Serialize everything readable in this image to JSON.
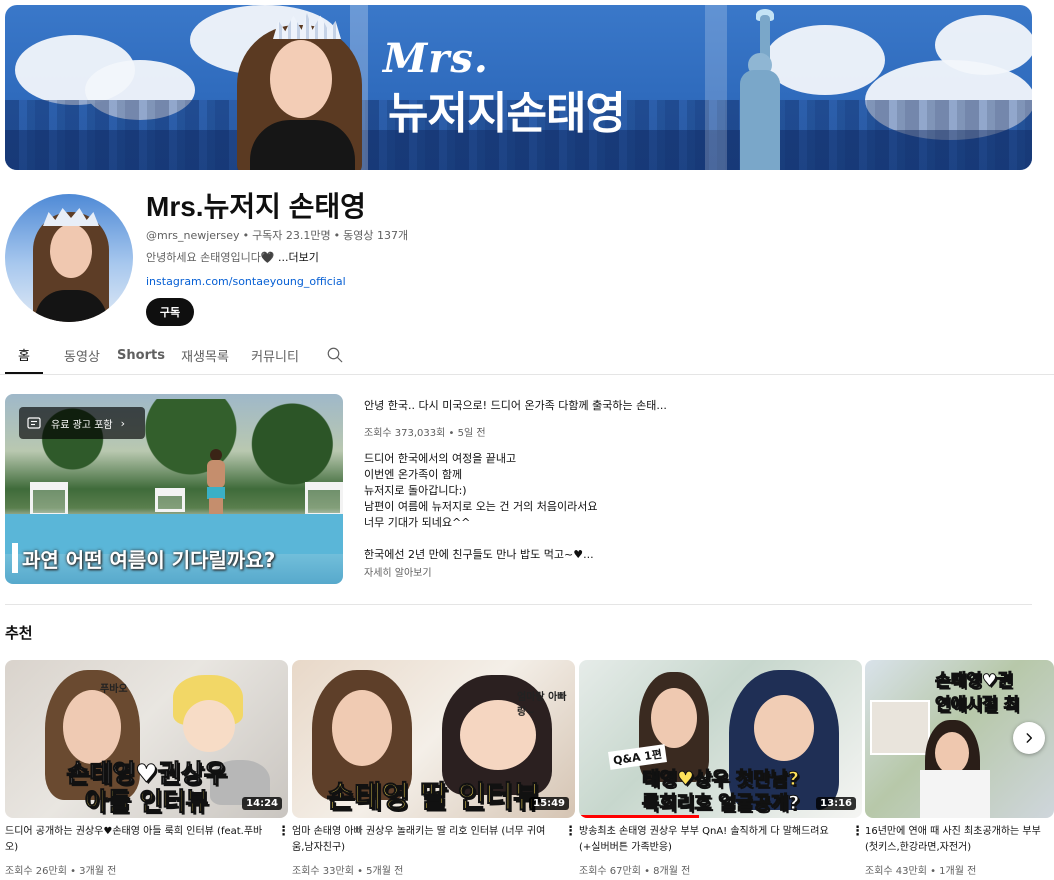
{
  "banner": {
    "title_line1": "Mrs.",
    "title_line2": "뉴저지손태영"
  },
  "channel": {
    "name": "Mrs.뉴저지 손태영",
    "handle": "@mrs_newjersey",
    "subscribers": "구독자 23.1만명",
    "videos": "동영상 137개",
    "description": "안녕하세요 손태영입니다🖤",
    "more_label": "...더보기",
    "link": "instagram.com/sontaeyoung_official",
    "subscribe_label": "구독"
  },
  "tabs": [
    {
      "label": "홈",
      "active": true
    },
    {
      "label": "동영상",
      "active": false
    },
    {
      "label": "Shorts",
      "active": false
    },
    {
      "label": "재생목록",
      "active": false
    },
    {
      "label": "커뮤니티",
      "active": false
    }
  ],
  "icons": {
    "tab_search": "search-icon",
    "ad_badge": "ad-icon",
    "carousel_next": "chevron-right-icon",
    "card_menu": "more-vert-icon"
  },
  "featured": {
    "ad_badge_label": "유료 광고 포함",
    "thumbnail_caption": "과연 어떤 여름이 기다릴까요?",
    "title": "안녕 한국.. 다시 미국으로! 드디어 온가족 다함께 출국하는 손태...",
    "stats": "조회수 373,033회 • 5일 전",
    "description_lines": [
      "드디어 한국에서의 여정을 끝내고",
      "이번엔 온가족이 함께",
      "뉴저지로 돌아갑니다:)",
      "남편이 여름에 뉴저지로 오는 건 거의 처음이라서요",
      "너무 기대가 되네요^^",
      "",
      "한국에선 2년 만에 친구들도 만나 밥도 먹고~♥..."
    ],
    "more_label": "자세히 알아보기"
  },
  "recommended": {
    "section_title": "추천",
    "videos": [
      {
        "thumb_text_top": "손태영♥권상우",
        "thumb_text_bottom": "아들 인터뷰",
        "thumb_overlay": "푸바오",
        "duration": "14:24",
        "title": "드디어 공개하는 권상우♥손태영 아들 룩희 인터뷰 (feat.푸바오)",
        "stats": "조회수 26만회 • 3개월 전"
      },
      {
        "thumb_text_top": "",
        "thumb_text_bottom": "손태영 딸 인터뷰",
        "thumb_overlay": "엄마랑 아빠랑~",
        "duration": "15:49",
        "title": "엄마 손태영 아빠 권상우 놀래키는 딸 리호 인터뷰 (너무 귀여움,남자친구)",
        "stats": "조회수 33만회 • 5개월 전"
      },
      {
        "thumb_text_top": "태영♥상우 첫만남?",
        "thumb_text_bottom": "룩희리호 얼굴공개?",
        "thumb_overlay": "Q&A 1편",
        "duration": "13:16",
        "title": "방송최초 손태영 권상우 부부 QnA! 솔직하게 다 말해드려요 (+실버버튼 가족반응)",
        "stats": "조회수 67만회 • 8개월 전"
      },
      {
        "thumb_text_top": "손태영♥권",
        "thumb_text_bottom": "연애시절 최",
        "thumb_overlay": "",
        "duration": "",
        "title": "16년만에 연애 때 사진 최초공개하는 부부 (첫키스,한강라면,자전거)",
        "stats": "조회수 43만회 • 1개월 전"
      }
    ]
  }
}
